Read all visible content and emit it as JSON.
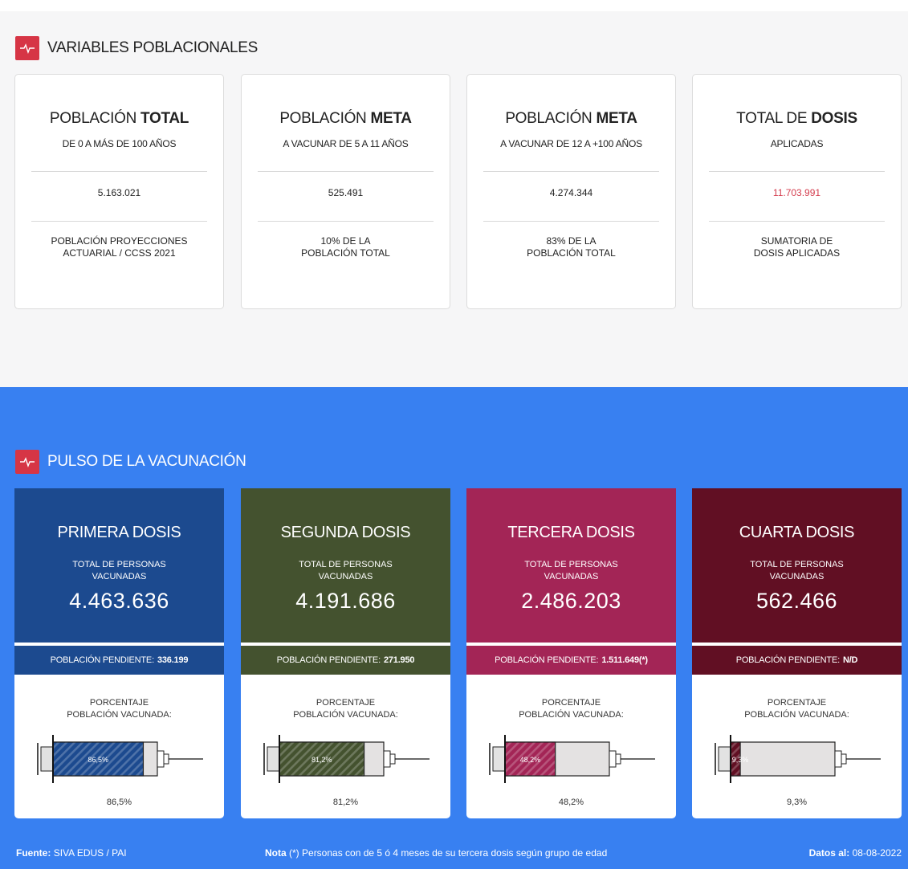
{
  "variables": {
    "title": "VARIABLES POBLACIONALES",
    "cards": [
      {
        "pre": "POBLACIÓN ",
        "bold": "TOTAL",
        "subtitle": "DE 0 A MÁS DE 100 AÑOS",
        "value": "5.163.021",
        "foot1": "POBLACIÓN PROYECCIONES",
        "foot2": "ACTUARIAL / CCSS 2021"
      },
      {
        "pre": "POBLACIÓN ",
        "bold": "META",
        "subtitle": "A VACUNAR DE 5 A 11 AÑOS",
        "value": "525.491",
        "foot1": "10% DE LA",
        "foot2": "POBLACIÓN TOTAL"
      },
      {
        "pre": "POBLACIÓN ",
        "bold": "META",
        "subtitle": "A VACUNAR DE 12 A +100 AÑOS",
        "value": "4.274.344",
        "foot1": "83% DE LA",
        "foot2": "POBLACIÓN TOTAL"
      },
      {
        "pre": "TOTAL DE ",
        "bold": "DOSIS",
        "subtitle": "APLICADAS",
        "value": "11.703.991",
        "foot1": "SUMATORIA DE",
        "foot2": "DOSIS APLICADAS"
      }
    ]
  },
  "pulso": {
    "title": "PULSO DE LA VACUNACIÓN",
    "cards": [
      {
        "title": "PRIMERA DOSIS",
        "sub1": "TOTAL DE PERSONAS",
        "sub2": "VACUNADAS",
        "number": "4.463.636",
        "pending_label": "POBLACIÓN PENDIENTE:",
        "pending_value": "336.199",
        "pct_label1": "PORCENTAJE",
        "pct_label2": "POBLACIÓN VACUNADA:",
        "pct_text": "86,5%",
        "pct": 86.5,
        "color": "#1c4a8f"
      },
      {
        "title": "SEGUNDA DOSIS",
        "sub1": "TOTAL DE PERSONAS",
        "sub2": "VACUNADAS",
        "number": "4.191.686",
        "pending_label": "POBLACIÓN PENDIENTE:",
        "pending_value": "271.950",
        "pct_label1": "PORCENTAJE",
        "pct_label2": "POBLACIÓN VACUNADA:",
        "pct_text": "81,2%",
        "pct": 81.2,
        "color": "#44522f"
      },
      {
        "title": "TERCERA DOSIS",
        "sub1": "TOTAL DE PERSONAS",
        "sub2": "VACUNADAS",
        "number": "2.486.203",
        "pending_label": "POBLACIÓN PENDIENTE:",
        "pending_value": "1.511.649(*)",
        "pct_label1": "PORCENTAJE",
        "pct_label2": "POBLACIÓN VACUNADA:",
        "pct_text": "48,2%",
        "pct": 48.2,
        "color": "#a32556"
      },
      {
        "title": "CUARTA DOSIS",
        "sub1": "TOTAL DE PERSONAS",
        "sub2": "VACUNADAS",
        "number": "562.466",
        "pending_label": "POBLACIÓN PENDIENTE:",
        "pending_value": "N/D",
        "pct_label1": "PORCENTAJE",
        "pct_label2": "POBLACIÓN VACUNADA:",
        "pct_text": "9,3%",
        "pct": 9.3,
        "color": "#610f23"
      }
    ]
  },
  "footer": {
    "fuente_label": "Fuente:",
    "fuente_value": "SIVA EDUS / PAI",
    "nota_label": "Nota",
    "nota_value": "(*) Personas con de 5 ó 4 meses de su tercera dosis según grupo de edad",
    "datos_label": "Datos al:",
    "datos_value": "08-08-2022"
  },
  "colors": {
    "accent_red": "#d63545",
    "blue_bg": "#3880f1",
    "value_red": "#d43d4e"
  }
}
